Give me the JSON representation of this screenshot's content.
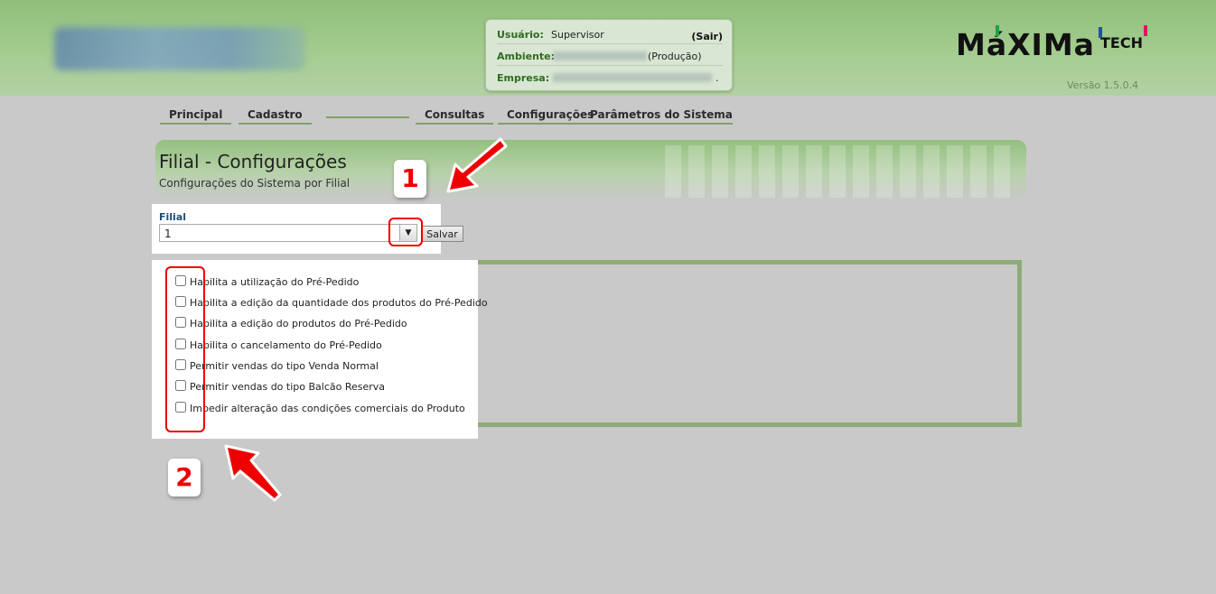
{
  "header": {
    "session": {
      "user_label": "Usuário:",
      "user_value": "Supervisor",
      "logout": "(Sair)",
      "env_label": "Ambiente:",
      "env_suffix": "(Produção)",
      "company_label": "Empresa:",
      "company_suffix": "."
    },
    "brand": {
      "name": "MáXIMa",
      "suffix": "TECH",
      "bar_colors": [
        "#1ea24a",
        "#1d4fb8",
        "#e0175f"
      ]
    },
    "version": "Versão 1.5.0.4"
  },
  "nav": {
    "items": [
      "Principal",
      "Cadastro",
      "Consultas",
      "Configurações",
      "Parâmetros do Sistema"
    ]
  },
  "page": {
    "title": "Filial - Configurações",
    "subtitle": "Configurações do Sistema por Filial"
  },
  "filial": {
    "label": "Filial",
    "selected": "1",
    "save_label": "Salvar"
  },
  "options": [
    "Habilita a utilização do Pré-Pedido",
    "Habilita a edição da quantidade dos produtos do Pré-Pedido",
    "Habilita a edição do produtos do Pré-Pedido",
    "Habilita o cancelamento do Pré-Pedido",
    "Permitir vendas do tipo Venda Normal",
    "Permitir vendas do tipo Balcão Reserva",
    "Impedir alteração das condições comerciais do Produto"
  ],
  "annotations": {
    "first": "1",
    "second": "2",
    "color": "#e00000"
  }
}
